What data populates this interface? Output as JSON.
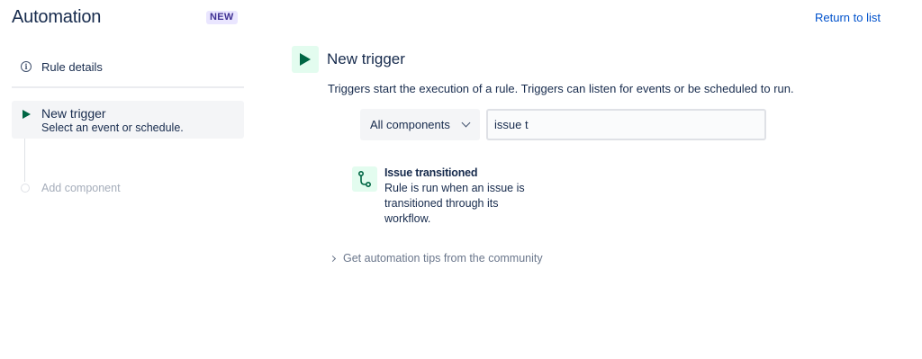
{
  "header": {
    "title": "Automation",
    "badge": "NEW",
    "return_link": "Return to list"
  },
  "sidebar": {
    "rule_details": "Rule details",
    "active_step": {
      "title": "New trigger",
      "subtitle": "Select an event or schedule."
    },
    "add_component": "Add component"
  },
  "main": {
    "title": "New trigger",
    "description": "Triggers start the execution of a rule. Triggers can listen for events or be scheduled to run.",
    "filter_select": {
      "selected": "All components"
    },
    "search": {
      "value": "issue t"
    },
    "results": [
      {
        "title": "Issue transitioned",
        "description": "Rule is run when an issue is transitioned through its workflow.",
        "icon": "transition-icon"
      }
    ],
    "tips_link": "Get automation tips from the community"
  },
  "colors": {
    "accent_green": "#006644",
    "green_bg": "#e3fcef",
    "link_blue": "#0052cc",
    "badge_bg": "#eae6ff",
    "badge_text": "#403294"
  }
}
